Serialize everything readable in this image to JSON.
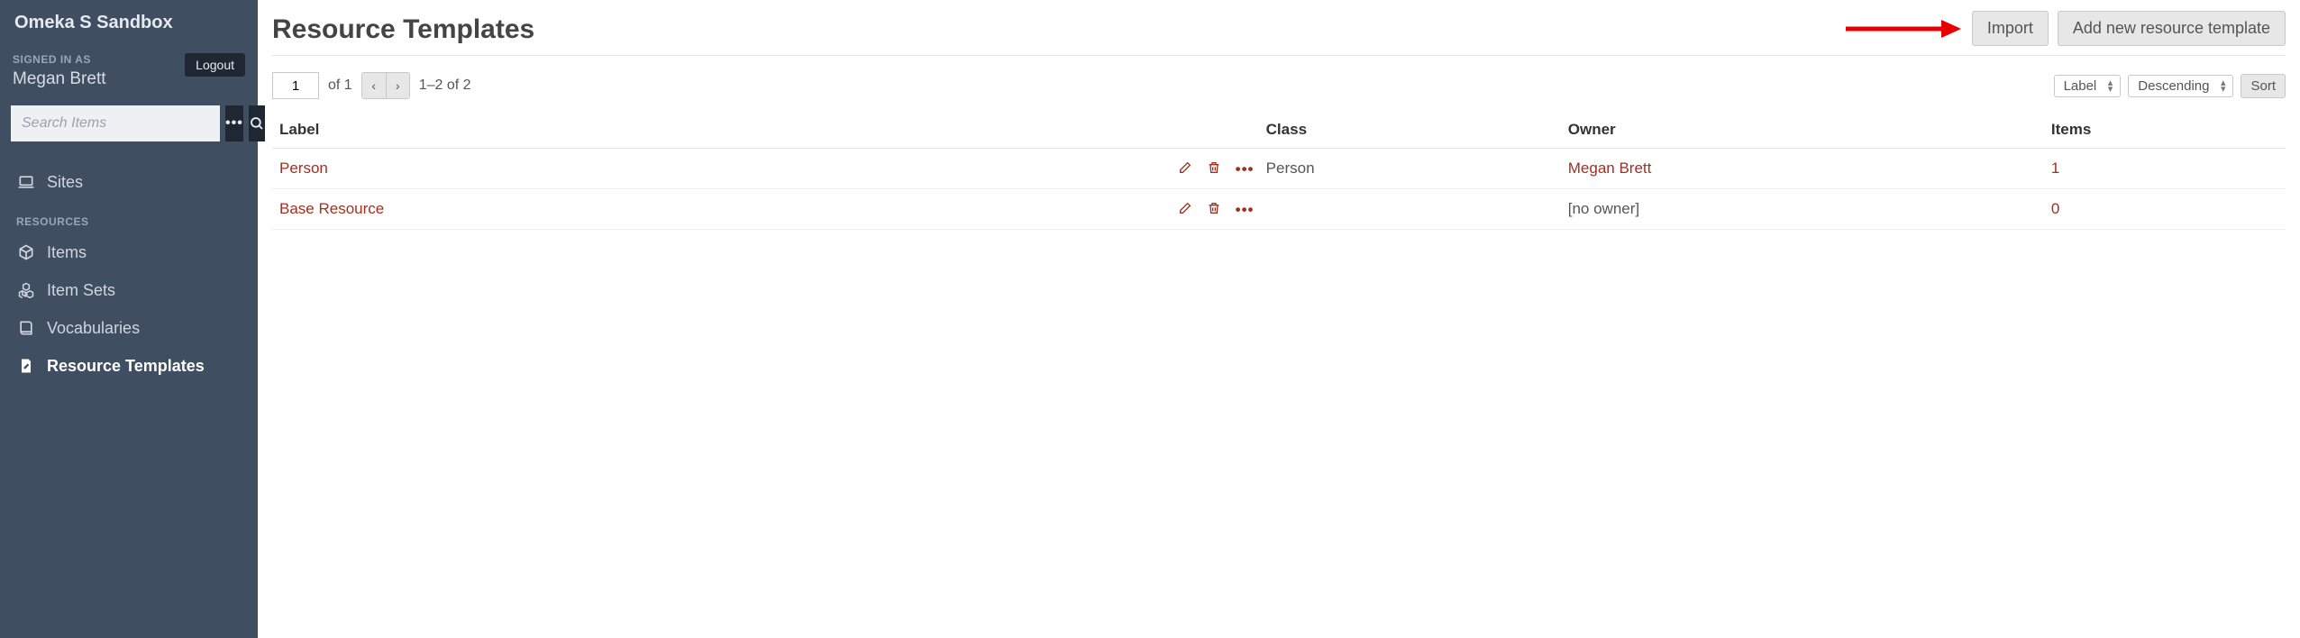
{
  "brand": "Omeka S Sandbox",
  "auth": {
    "signed_in_caption": "SIGNED IN AS",
    "user_name": "Megan Brett",
    "logout_label": "Logout"
  },
  "search": {
    "placeholder": "Search Items"
  },
  "nav": {
    "sites": "Sites",
    "resources_heading": "RESOURCES",
    "items": "Items",
    "item_sets": "Item Sets",
    "vocabularies": "Vocabularies",
    "resource_templates": "Resource Templates"
  },
  "page": {
    "title": "Resource Templates",
    "import_label": "Import",
    "add_label": "Add new resource template"
  },
  "pagination": {
    "page_input": "1",
    "of_pages": "of 1",
    "range": "1–2 of 2"
  },
  "sort": {
    "field": "Label",
    "direction": "Descending",
    "sort_label": "Sort"
  },
  "table": {
    "headers": {
      "label": "Label",
      "class": "Class",
      "owner": "Owner",
      "items": "Items"
    },
    "rows": [
      {
        "label": "Person",
        "class": "Person",
        "owner": "Megan Brett",
        "owner_link": true,
        "items": "1"
      },
      {
        "label": "Base Resource",
        "class": "",
        "owner": "[no owner]",
        "owner_link": false,
        "items": "0"
      }
    ]
  }
}
